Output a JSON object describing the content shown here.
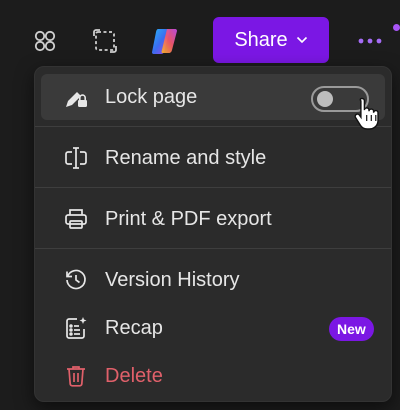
{
  "toolbar": {
    "icons": [
      "apps-icon",
      "focus-frame-icon",
      "copilot-icon"
    ],
    "share_label": "Share",
    "more_icon": "more-dots-icon"
  },
  "menu": {
    "lock": {
      "label": "Lock page",
      "icon": "lock-pen-icon",
      "toggle_on": false
    },
    "rename": {
      "label": "Rename and style",
      "icon": "rename-icon"
    },
    "print": {
      "label": "Print & PDF export",
      "icon": "printer-icon"
    },
    "history": {
      "label": "Version History",
      "icon": "history-icon"
    },
    "recap": {
      "label": "Recap",
      "icon": "recap-sparkle-icon",
      "badge": "New"
    },
    "delete": {
      "label": "Delete",
      "icon": "trash-icon"
    }
  },
  "colors": {
    "accent": "#7b17e4",
    "danger": "#e0606a",
    "background": "#1c1c1c",
    "menu_bg": "#2b2b2b"
  }
}
